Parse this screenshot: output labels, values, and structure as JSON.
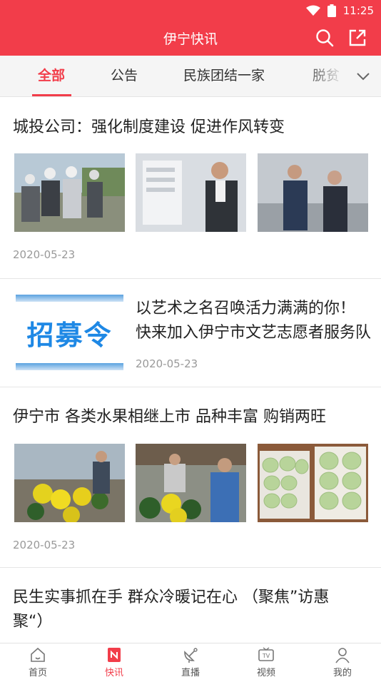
{
  "status_bar": {
    "time": "11:25",
    "icons": [
      "wifi-icon",
      "battery-icon"
    ]
  },
  "header": {
    "title": "伊宁快讯",
    "icons": [
      "search-icon",
      "share-icon"
    ],
    "color": "#f23d4a"
  },
  "tabs": {
    "items": [
      {
        "label": "全部",
        "active": true
      },
      {
        "label": "公告",
        "active": false
      },
      {
        "label": "民族团结一家",
        "active": false
      },
      {
        "label": "脱贫",
        "active": false
      }
    ],
    "more_icon": "chevron-down-icon"
  },
  "feed": [
    {
      "title": "城投公司：强化制度建设   促进作风转变",
      "date": "2020-05-23"
    },
    {
      "title_line1": "以艺术之名召唤活力满满的你！",
      "title_line2": "快来加入伊宁市文艺志愿者服务队",
      "date": "2020-05-23",
      "thumb_text": "招募令"
    },
    {
      "title": "伊宁市   各类水果相继上市   品种丰富   购销两旺",
      "date": "2020-05-23"
    },
    {
      "title_line1": "民生实事抓在手   群众冷暖记在心    （聚焦”访惠",
      "title_line2": "聚“）"
    }
  ],
  "bottom_nav": [
    {
      "label": "首页",
      "icon": "home-icon",
      "active": false
    },
    {
      "label": "快讯",
      "icon": "news-icon",
      "active": true
    },
    {
      "label": "直播",
      "icon": "satellite-icon",
      "active": false
    },
    {
      "label": "视频",
      "icon": "tv-icon",
      "active": false
    },
    {
      "label": "我的",
      "icon": "user-icon",
      "active": false
    }
  ],
  "colors": {
    "accent": "#f23d4a",
    "text_muted": "#999999"
  }
}
